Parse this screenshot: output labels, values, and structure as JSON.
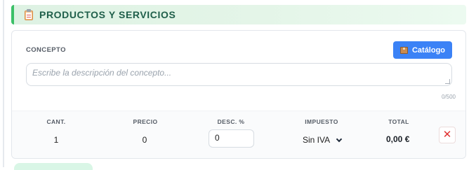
{
  "section": {
    "title": "PRODUCTOS Y SERVICIOS",
    "icon": "clipboard-icon"
  },
  "concept": {
    "label": "CONCEPTO",
    "catalog_button": "Catálogo",
    "catalog_icon": "package-icon",
    "placeholder": "Escribe la descripción del concepto...",
    "char_count": "0/500"
  },
  "items": {
    "headers": {
      "qty": "CANT.",
      "price": "PRECIO",
      "discount": "DESC. %",
      "tax": "IMPUESTO",
      "total": "TOTAL"
    },
    "row": {
      "qty": "1",
      "price": "0",
      "discount": "0",
      "tax": "Sin IVA",
      "total": "0,00 €",
      "delete": "✕"
    }
  },
  "colors": {
    "accent_green": "#3cc068",
    "button_blue": "#3b82f6",
    "delete_red": "#e03131"
  }
}
